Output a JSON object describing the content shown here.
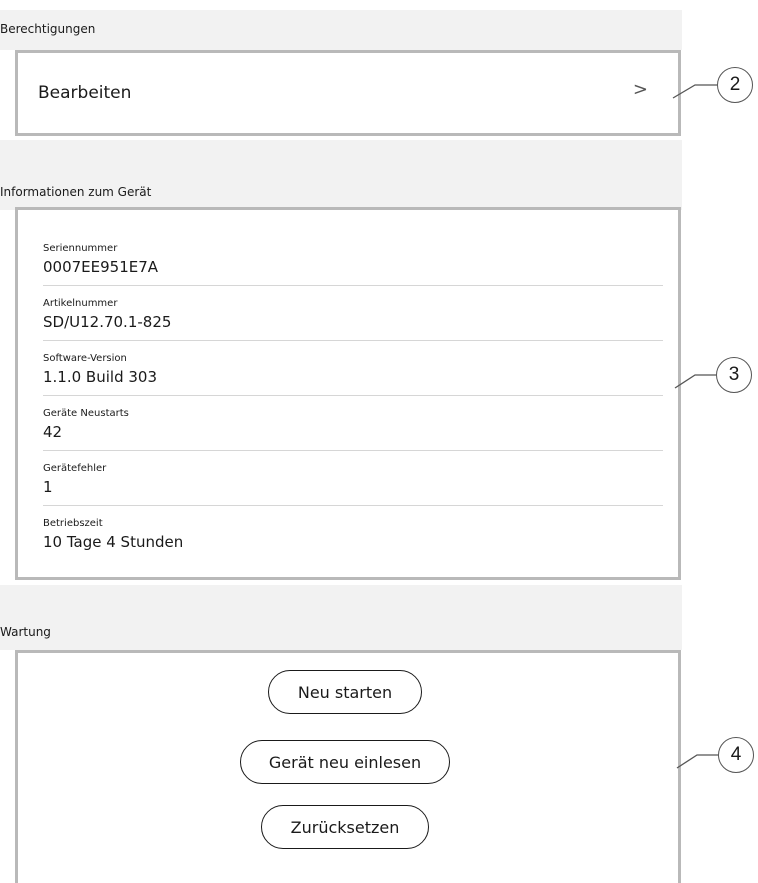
{
  "permissions": {
    "section_title": "Berechtigungen",
    "edit_label": "Bearbeiten",
    "chevron": ">",
    "callout": "2"
  },
  "device_info": {
    "section_title": "Informationen zum Gerät",
    "callout": "3",
    "rows": [
      {
        "label": "Seriennummer",
        "value": "0007EE951E7A"
      },
      {
        "label": "Artikelnummer",
        "value": "SD/U12.70.1-825"
      },
      {
        "label": "Software-Version",
        "value": "1.1.0 Build 303"
      },
      {
        "label": "Geräte Neustarts",
        "value": "42"
      },
      {
        "label": "Gerätefehler",
        "value": "1"
      },
      {
        "label": "Betriebszeit",
        "value": "10 Tage 4 Stunden"
      }
    ]
  },
  "maintenance": {
    "section_title": "Wartung",
    "callout": "4",
    "restart_label": "Neu starten",
    "rescan_label": "Gerät neu einlesen",
    "reset_label": "Zurücksetzen"
  }
}
